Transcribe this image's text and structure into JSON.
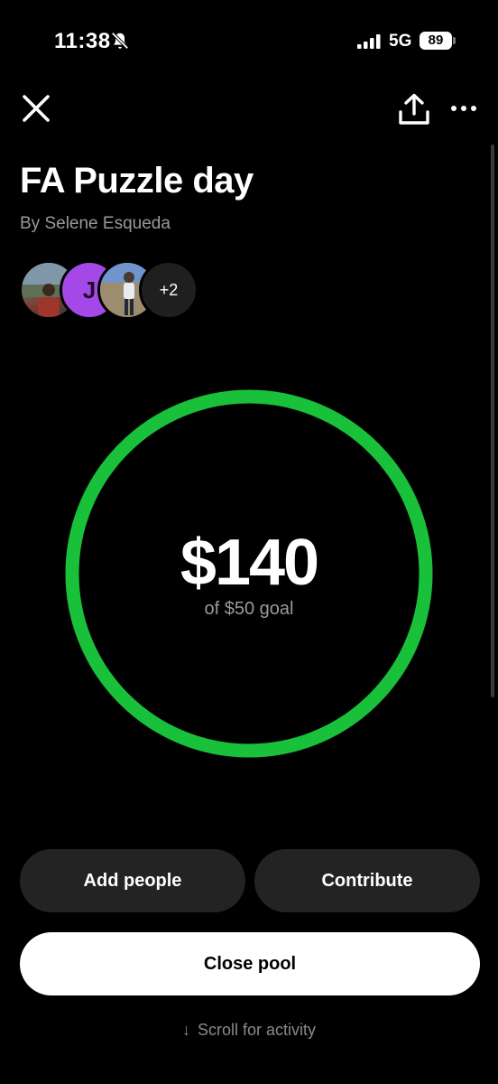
{
  "status_bar": {
    "time": "11:38",
    "network": "5G",
    "battery": "89"
  },
  "nav": {
    "close_icon": "close-icon",
    "share_icon": "share-icon",
    "more_icon": "more-icon"
  },
  "pool": {
    "title": "FA Puzzle day",
    "byline": "By Selene Esqueda",
    "avatar_initial": "J",
    "extra_members": "+2",
    "amount": "$140",
    "goal_text": "of $50 goal",
    "ring_color": "#19c03a",
    "progress_fraction": 1.0
  },
  "actions": {
    "add_people": "Add people",
    "contribute": "Contribute",
    "close_pool": "Close pool"
  },
  "footer": {
    "scroll_arrow": "↓",
    "scroll_hint": "Scroll for activity"
  }
}
